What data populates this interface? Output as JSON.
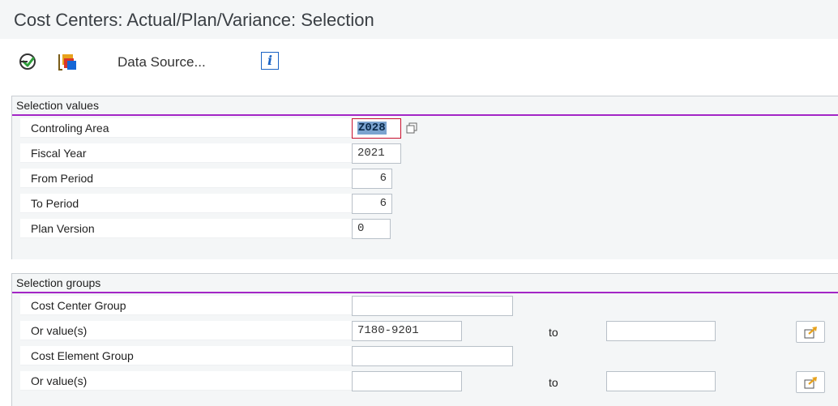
{
  "title": "Cost Centers: Actual/Plan/Variance: Selection",
  "toolbar": {
    "execute_icon": "execute-icon",
    "variant_icon": "get-variant-icon",
    "data_source_label": "Data Source...",
    "info_label": "i"
  },
  "selection_values": {
    "header": "Selection values",
    "fields": [
      {
        "label": "Controling Area",
        "value": "Z028"
      },
      {
        "label": "Fiscal Year",
        "value": "2021"
      },
      {
        "label": "From Period",
        "value": "6"
      },
      {
        "label": "To Period",
        "value": "6"
      },
      {
        "label": "Plan Version",
        "value": "0"
      }
    ]
  },
  "selection_groups": {
    "header": "Selection groups",
    "rows": [
      {
        "label": "Cost Center Group",
        "value": ""
      },
      {
        "label": "Or value(s)",
        "value": "7180-9201",
        "to_label": "to",
        "to_value": ""
      },
      {
        "label": "Cost Element Group",
        "value": ""
      },
      {
        "label": "Or value(s)",
        "value": "",
        "to_label": "to",
        "to_value": ""
      }
    ]
  },
  "colors": {
    "accent_line": "#a326c6",
    "focus_border": "#c8102e",
    "selection_highlight": "#7ba3cf",
    "panel_background": "#f4f6f7"
  }
}
